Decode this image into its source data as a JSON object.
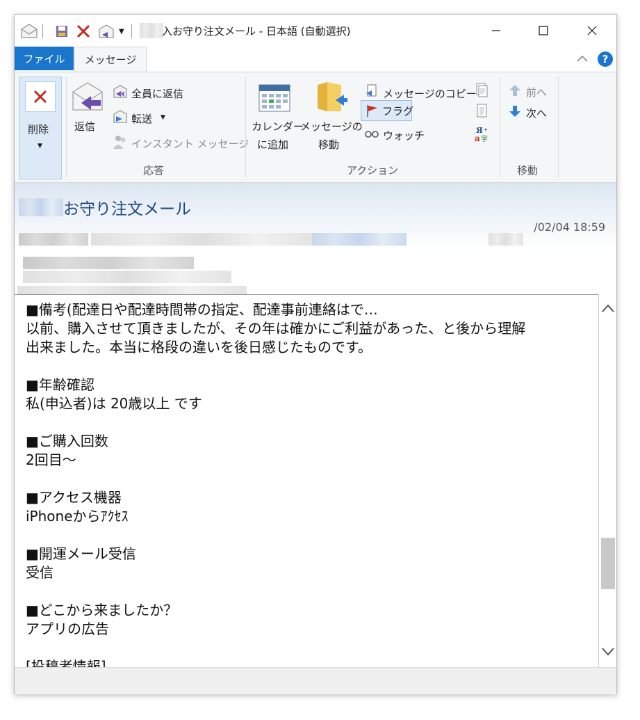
{
  "window": {
    "title": "入お守り注文メール - 日本語 (自動選択)"
  },
  "tabs": [
    {
      "label": "ファイル"
    },
    {
      "label": "メッセージ"
    }
  ],
  "ribbon": {
    "delete_label": "削除",
    "reply_label": "返信",
    "reply_all_label": "全員に返信",
    "forward_label": "転送",
    "instant_message_label": "インスタント メッセージ",
    "calendar_label_1": "カレンダー",
    "calendar_label_2": "に追加",
    "move_label_1": "メッセージの",
    "move_label_2": "移動",
    "copy_label": "メッセージのコピー",
    "flag_label": "フラグ",
    "watch_label": "ウォッチ",
    "prev_label": "前へ",
    "next_label": "次へ",
    "groups": {
      "respond": "応答",
      "actions": "アクション",
      "move": "移動"
    }
  },
  "message": {
    "subject": "お守り注文メール",
    "date": "/02/04 18:59",
    "body": "■備考(配達日や配達時間帯の指定、配達事前連絡はで…\n以前、購入させて頂きましたが、その年は確かにご利益があった、と後から理解\n出来ました。本当に格段の違いを後日感じたものです。\n\n■年齢確認\n私(申込者)は 20歳以上 です\n\n■ご購入回数\n2回目〜\n\n■アクセス機器\niPhoneからｱｸｾｽ\n\n■開運メール受信\n受信\n\n■どこから来ましたか？\nアプリの広告\n\n[投稿者情報]"
  }
}
